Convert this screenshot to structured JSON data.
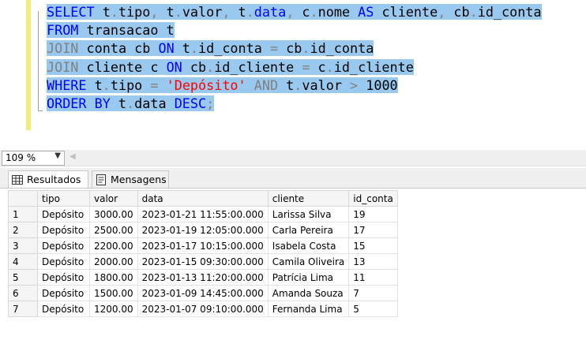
{
  "editor": {
    "lines": [
      [
        {
          "t": "SELECT",
          "c": "kw"
        },
        {
          "t": " t",
          "c": "id"
        },
        {
          "t": ".",
          "c": "op"
        },
        {
          "t": "tipo",
          "c": "id"
        },
        {
          "t": ",",
          "c": "op"
        },
        {
          "t": " t",
          "c": "id"
        },
        {
          "t": ".",
          "c": "op"
        },
        {
          "t": "valor",
          "c": "id"
        },
        {
          "t": ",",
          "c": "op"
        },
        {
          "t": " t",
          "c": "id"
        },
        {
          "t": ".",
          "c": "op"
        },
        {
          "t": "data",
          "c": "kw"
        },
        {
          "t": ",",
          "c": "op"
        },
        {
          "t": " c",
          "c": "id"
        },
        {
          "t": ".",
          "c": "op"
        },
        {
          "t": "nome ",
          "c": "id"
        },
        {
          "t": "AS",
          "c": "kw"
        },
        {
          "t": " cliente",
          "c": "id"
        },
        {
          "t": ",",
          "c": "op"
        },
        {
          "t": " cb",
          "c": "id"
        },
        {
          "t": ".",
          "c": "op"
        },
        {
          "t": "id_conta",
          "c": "id"
        }
      ],
      [
        {
          "t": "FROM",
          "c": "kw"
        },
        {
          "t": " transacao t",
          "c": "id"
        }
      ],
      [
        {
          "t": "JOIN",
          "c": "op"
        },
        {
          "t": " conta cb ",
          "c": "id"
        },
        {
          "t": "ON",
          "c": "kw"
        },
        {
          "t": " t",
          "c": "id"
        },
        {
          "t": ".",
          "c": "op"
        },
        {
          "t": "id_conta ",
          "c": "id"
        },
        {
          "t": "=",
          "c": "op"
        },
        {
          "t": " cb",
          "c": "id"
        },
        {
          "t": ".",
          "c": "op"
        },
        {
          "t": "id_conta",
          "c": "id"
        }
      ],
      [
        {
          "t": "JOIN",
          "c": "op"
        },
        {
          "t": " cliente c ",
          "c": "id"
        },
        {
          "t": "ON",
          "c": "kw"
        },
        {
          "t": " cb",
          "c": "id"
        },
        {
          "t": ".",
          "c": "op"
        },
        {
          "t": "id_cliente ",
          "c": "id"
        },
        {
          "t": "=",
          "c": "op"
        },
        {
          "t": " c",
          "c": "id"
        },
        {
          "t": ".",
          "c": "op"
        },
        {
          "t": "id_cliente",
          "c": "id"
        }
      ],
      [
        {
          "t": "WHERE",
          "c": "kw"
        },
        {
          "t": " t",
          "c": "id"
        },
        {
          "t": ".",
          "c": "op"
        },
        {
          "t": "tipo ",
          "c": "id"
        },
        {
          "t": "=",
          "c": "op"
        },
        {
          "t": " ",
          "c": "id"
        },
        {
          "t": "'Depósito'",
          "c": "str"
        },
        {
          "t": " ",
          "c": "id"
        },
        {
          "t": "AND",
          "c": "op"
        },
        {
          "t": " t",
          "c": "id"
        },
        {
          "t": ".",
          "c": "op"
        },
        {
          "t": "valor ",
          "c": "id"
        },
        {
          "t": ">",
          "c": "op"
        },
        {
          "t": " 1000",
          "c": "num"
        }
      ],
      [
        {
          "t": "ORDER BY",
          "c": "kw"
        },
        {
          "t": " t",
          "c": "id"
        },
        {
          "t": ".",
          "c": "op"
        },
        {
          "t": "data ",
          "c": "id"
        },
        {
          "t": "DESC",
          "c": "kw"
        },
        {
          "t": ";",
          "c": "op"
        }
      ]
    ]
  },
  "status": {
    "zoom": "109 %"
  },
  "tabs": {
    "results": "Resultados",
    "messages": "Mensagens"
  },
  "grid": {
    "columns": [
      "tipo",
      "valor",
      "data",
      "cliente",
      "id_conta"
    ],
    "rows": [
      {
        "n": "1",
        "tipo": "Depósito",
        "valor": "3000.00",
        "data": "2023-01-21 11:55:00.000",
        "cliente": "Larissa Silva",
        "id_conta": "19"
      },
      {
        "n": "2",
        "tipo": "Depósito",
        "valor": "2500.00",
        "data": "2023-01-19 12:05:00.000",
        "cliente": "Carla Pereira",
        "id_conta": "17"
      },
      {
        "n": "3",
        "tipo": "Depósito",
        "valor": "2200.00",
        "data": "2023-01-17 10:15:00.000",
        "cliente": "Isabela Costa",
        "id_conta": "15"
      },
      {
        "n": "4",
        "tipo": "Depósito",
        "valor": "2000.00",
        "data": "2023-01-15 09:30:00.000",
        "cliente": "Camila Oliveira",
        "id_conta": "13"
      },
      {
        "n": "5",
        "tipo": "Depósito",
        "valor": "1800.00",
        "data": "2023-01-13 11:20:00.000",
        "cliente": "Patrícia Lima",
        "id_conta": "11"
      },
      {
        "n": "6",
        "tipo": "Depósito",
        "valor": "1500.00",
        "data": "2023-01-09 14:45:00.000",
        "cliente": "Amanda Souza",
        "id_conta": "7"
      },
      {
        "n": "7",
        "tipo": "Depósito",
        "valor": "1200.00",
        "data": "2023-01-07 09:10:00.000",
        "cliente": "Fernanda Lima",
        "id_conta": "5"
      }
    ]
  },
  "colors": {
    "selection": "#99c9ef",
    "keyword": "#0000ff",
    "operator": "#808080",
    "string": "#ff0000",
    "change_bar": "#f5ec7a"
  }
}
